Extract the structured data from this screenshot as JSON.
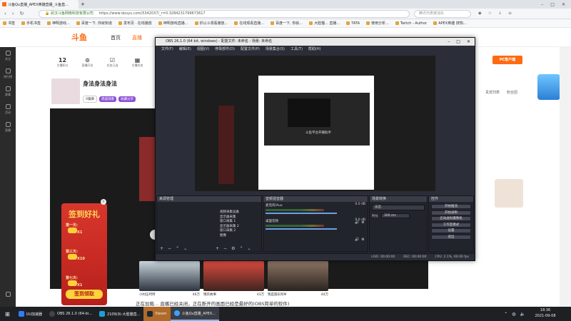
{
  "browser": {
    "tabs": [
      {
        "label": "斗鱼Qu直播_APEX英雄直播_斗鱼直..."
      }
    ],
    "url": "https://www.douyu.com/5342037/_r=0.3284231799673617",
    "ssl_note": "武汉斗鱼网络科技有限公司",
    "search_placeholder": "腾讯代表被消失",
    "bookmarks": [
      "书签",
      "手机书签",
      "神明游戏...",
      "百度一下, 你就知道",
      "发布页 · 在线播放",
      "神明游戏直播...",
      "折以斗观看播放...",
      "在线观看直播...",
      "百度一下, 你就...",
      "大脸猫... 直播...",
      "TATA",
      "使用分析...",
      "Twitch - Author",
      "APEX英雄 搜狗..."
    ]
  },
  "site": {
    "logo": "斗鱼",
    "nav": [
      "首页",
      "直播"
    ],
    "stats": [
      {
        "value": "12",
        "label": "主播积分"
      },
      {
        "value": "",
        "label": "直播开关"
      },
      {
        "value": "",
        "label": "任务已连"
      },
      {
        "value": "",
        "label": "主播任务"
      }
    ],
    "streamer_name": "身法身法身法",
    "streamer_tags": [
      "V徽章",
      "鼎盛观看",
      "收藏分享"
    ],
    "leftnav": [
      "关注",
      "排行榜",
      "赛事",
      "活动",
      "直播"
    ],
    "pc_button": "PC客户端",
    "right_tabs": [
      "贵宾列表",
      "粉丝团"
    ],
    "gift_popup": {
      "title": "签到好礼",
      "days": [
        {
          "label": "第一天:",
          "amount": "X1"
        },
        {
          "label": "第三天:",
          "amount": "X10"
        },
        {
          "label": "第七天:",
          "amount": "X1"
        }
      ],
      "button": "签到领取",
      "close": "×"
    },
    "thumbnails": [
      {
        "title": "小村庄呵呵",
        "count": "46万"
      },
      {
        "title": "锦衣故事",
        "count": "43万"
      },
      {
        "title": "我是圆东阿M",
        "count": "44万"
      }
    ],
    "bottom_text": "正在加载... 直播已经关闭，正在断开的画面已经是最好的(OBS简单的软件)"
  },
  "obs": {
    "title": "OBS 26.1.0 (64 bit, windows) - 配置文件: 未命名 - 场景: 未命名",
    "menu": [
      "文件(F)",
      "编辑(E)",
      "视图(V)",
      "停靠部件(D)",
      "配置文件(P)",
      "场景集合(S)",
      "工具(T)",
      "帮助(H)"
    ],
    "preview_text": "斗鱼平台开播助手",
    "panels": {
      "scenes": "来源管理",
      "mixer": "音频混音器",
      "transitions": "场景转换",
      "controls": "控件"
    },
    "sources": [
      "视频采集设备",
      "显示器采集",
      "窗口采集 1",
      "显示器采集 2",
      "窗口采集 2",
      "图像"
    ],
    "mixer": [
      {
        "name": "麦克风/Aux",
        "value": "0.0 dB"
      },
      {
        "name": "桌面音频",
        "value": "0.0 dB"
      }
    ],
    "transition": {
      "type": "淡出",
      "duration_label": "时长",
      "duration": "300 ms"
    },
    "controls": [
      "开始推流",
      "开始录制",
      "启动虚拟摄像机",
      "工作室模式",
      "设置",
      "退出"
    ],
    "status": {
      "live": "LIVE: 00:00:00",
      "rec": "REC: 00:00:00",
      "cpu": "CPU: 2.1%, 60.00 fps"
    }
  },
  "taskbar": {
    "items": [
      "UU加速器",
      "OBS 26.1.0 (64-bi...",
      "2109(9)-大脸猫直...",
      "Steam",
      "斗鱼Qu直播_APEX..."
    ],
    "active_index": 4,
    "time": "18:36",
    "date": "2021-09-08"
  },
  "colors": {
    "accent": "#ff6a13",
    "obs_bg": "#2b2e38",
    "gift_red": "#d8372c",
    "gift_gold": "#ffd33b"
  }
}
